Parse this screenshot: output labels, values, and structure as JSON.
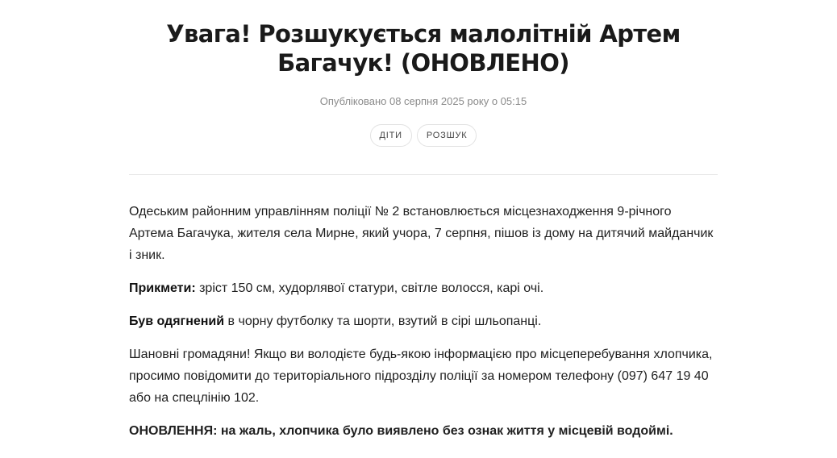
{
  "article": {
    "title": "Увага! Розшукується малолітній Артем Багачук! (ОНОВЛЕНО)",
    "meta": "Опубліковано 08 серпня 2025 року о 05:15",
    "tags": [
      "ДІТИ",
      "РОЗШУК"
    ],
    "paragraph_1": "Одеським районним управлінням поліції № 2 встановлюється місцезнаходження 9-річного Артема Багачука, жителя села Мирне, який учора, 7 серпня, пішов із дому на дитячий майданчик і зник.",
    "signs": {
      "label": "Прикмети:",
      "text": " зріст 150 см, худорлявої статури, світле волосся, карі очі."
    },
    "clothing": {
      "label": "Був одягнений",
      "text": " в чорну футболку та шорти, взутий в сірі шльопанці."
    },
    "paragraph_appeal": "Шановні громадяни! Якщо ви володієте будь-якою інформацією про місцеперебування хлопчика, просимо повідомити до територіального підрозділу поліції за  номером телефону  (097) 647 19 40 або на спецлінію 102.",
    "update": {
      "label": "ОНОВЛЕННЯ:",
      "text": " на жаль, хлопчика було виявлено без ознак життя у місцевій водоймі."
    }
  },
  "colors": {
    "text": "#1a1a1a",
    "meta": "#8a8a8a",
    "tag_border": "#e2e2e2",
    "divider": "#e8e8e8"
  }
}
